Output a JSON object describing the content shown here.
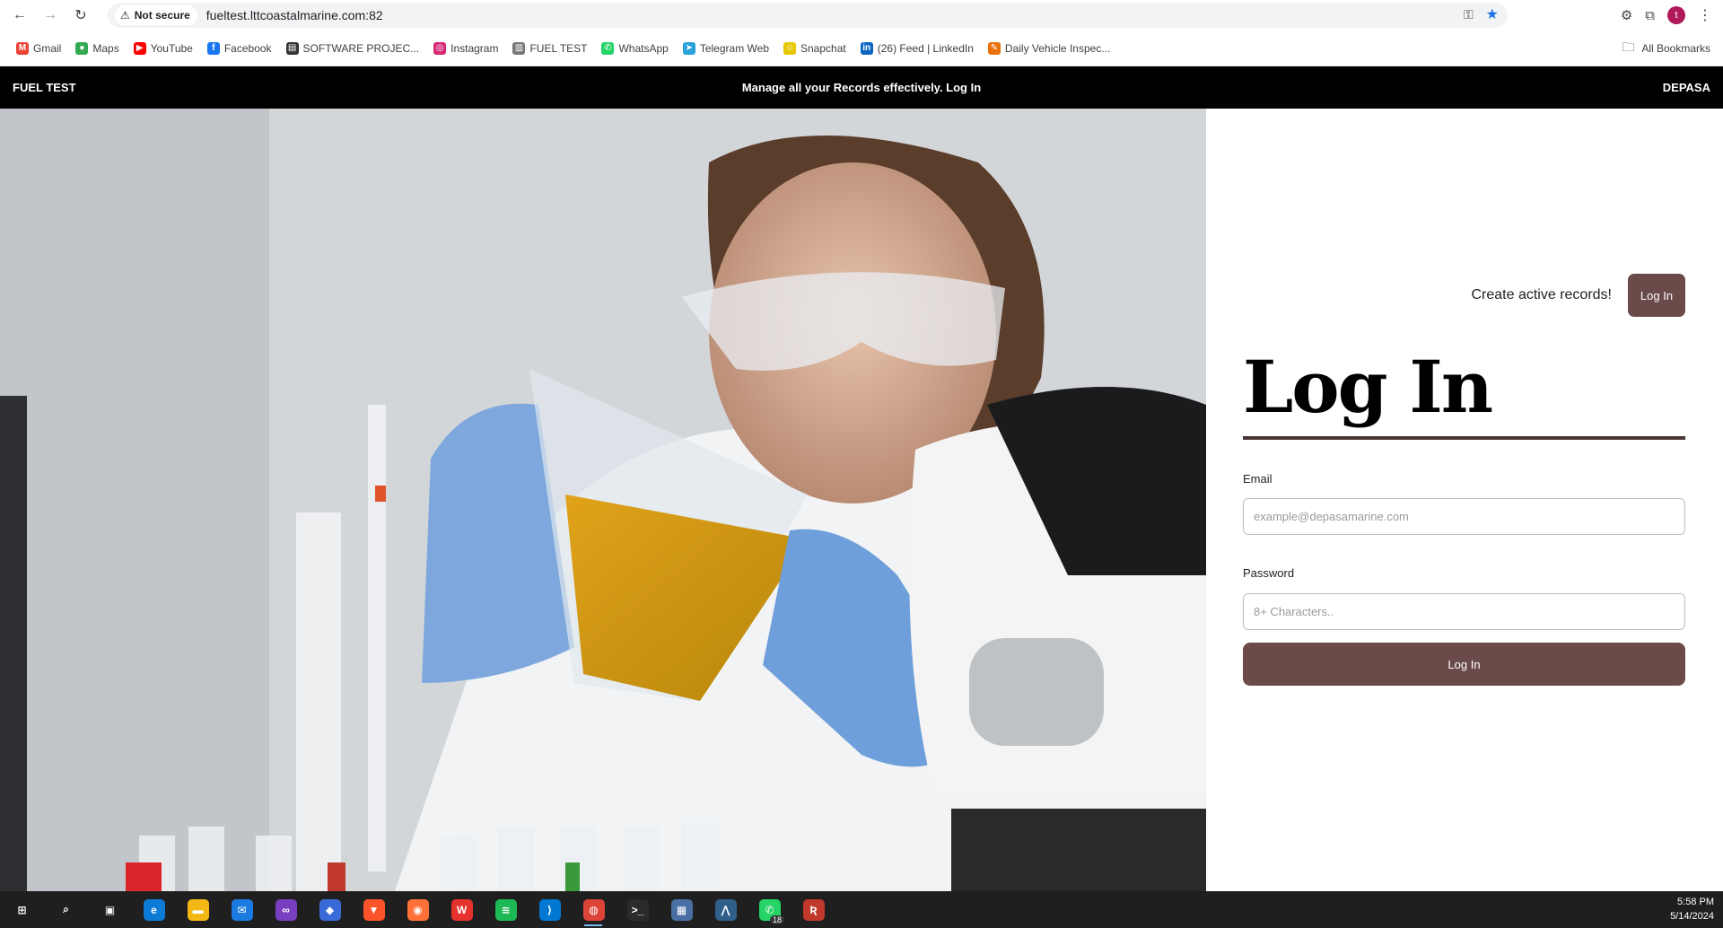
{
  "browser": {
    "security_label": "Not secure",
    "url": "fueltest.lttcoastalmarine.com:82",
    "avatar_letter": "t",
    "bookmarks": [
      {
        "label": "Gmail",
        "icon": "gmail-icon",
        "color": "#ea4335",
        "glyph": "M"
      },
      {
        "label": "Maps",
        "icon": "maps-icon",
        "color": "#34a853",
        "glyph": "●"
      },
      {
        "label": "YouTube",
        "icon": "youtube-icon",
        "color": "#ff0000",
        "glyph": "▶"
      },
      {
        "label": "Facebook",
        "icon": "facebook-icon",
        "color": "#1877f2",
        "glyph": "f"
      },
      {
        "label": "SOFTWARE PROJEC...",
        "icon": "film-icon",
        "color": "#333333",
        "glyph": "▤"
      },
      {
        "label": "Instagram",
        "icon": "instagram-icon",
        "color": "#d62976",
        "glyph": "◎"
      },
      {
        "label": "FUEL TEST",
        "icon": "site-icon",
        "color": "#777777",
        "glyph": "▥"
      },
      {
        "label": "WhatsApp",
        "icon": "whatsapp-icon",
        "color": "#25d366",
        "glyph": "✆"
      },
      {
        "label": "Telegram Web",
        "icon": "telegram-icon",
        "color": "#2aa1da",
        "glyph": "➤"
      },
      {
        "label": "Snapchat",
        "icon": "snapchat-icon",
        "color": "#e6c700",
        "glyph": "☺"
      },
      {
        "label": "(26) Feed | LinkedIn",
        "icon": "linkedin-icon",
        "color": "#0a66c2",
        "glyph": "in"
      },
      {
        "label": "Daily Vehicle Inspec...",
        "icon": "form-icon",
        "color": "#e8710a",
        "glyph": "✎"
      }
    ],
    "all_bookmarks_label": "All Bookmarks"
  },
  "app": {
    "brand": "FUEL TEST",
    "tagline": "Manage all your Records effectively. Log In",
    "company": "DEPASA",
    "cta_text": "Create active records!",
    "cta_button": "Log In",
    "title": "Log In",
    "email_label": "Email",
    "email_placeholder": "example@depasamarine.com",
    "password_label": "Password",
    "password_placeholder": "8+ Characters..",
    "submit_label": "Log In",
    "accent_color": "#6b4a4a"
  },
  "taskbar": {
    "apps": [
      {
        "name": "start-icon",
        "color": "#1f1f1f",
        "glyph": "⊞"
      },
      {
        "name": "search-icon",
        "color": "#1f1f1f",
        "glyph": "⌕"
      },
      {
        "name": "task-view-icon",
        "color": "#1f1f1f",
        "glyph": "▣"
      },
      {
        "name": "edge-icon",
        "color": "#0c7bd6",
        "glyph": "e"
      },
      {
        "name": "file-explorer-icon",
        "color": "#f3b816",
        "glyph": "▬"
      },
      {
        "name": "mail-icon",
        "color": "#1b7be0",
        "glyph": "✉"
      },
      {
        "name": "app-purple-icon",
        "color": "#7a3fc0",
        "glyph": "∞"
      },
      {
        "name": "app-blue-icon",
        "color": "#3a6ad8",
        "glyph": "◆"
      },
      {
        "name": "brave-icon",
        "color": "#fb542b",
        "glyph": "▼"
      },
      {
        "name": "firefox-icon",
        "color": "#ff7139",
        "glyph": "◉"
      },
      {
        "name": "wps-icon",
        "color": "#e6322c",
        "glyph": "W"
      },
      {
        "name": "spotify-icon",
        "color": "#1db954",
        "glyph": "≋"
      },
      {
        "name": "vscode-icon",
        "color": "#0078d4",
        "glyph": "⟩"
      },
      {
        "name": "chrome-icon",
        "color": "#db4437",
        "glyph": "◍",
        "active": true
      },
      {
        "name": "terminal-icon",
        "color": "#2b2b2b",
        "glyph": ">_"
      },
      {
        "name": "app-monitor-icon",
        "color": "#4a6fa5",
        "glyph": "▦"
      },
      {
        "name": "app-chart-icon",
        "color": "#2f5f8a",
        "glyph": "⋀"
      },
      {
        "name": "whatsapp-icon",
        "color": "#25d366",
        "glyph": "✆",
        "badge": "18"
      },
      {
        "name": "app-red-icon",
        "color": "#c0392b",
        "glyph": "Ʀ"
      }
    ],
    "time": "5:58 PM",
    "date": "5/14/2024"
  }
}
